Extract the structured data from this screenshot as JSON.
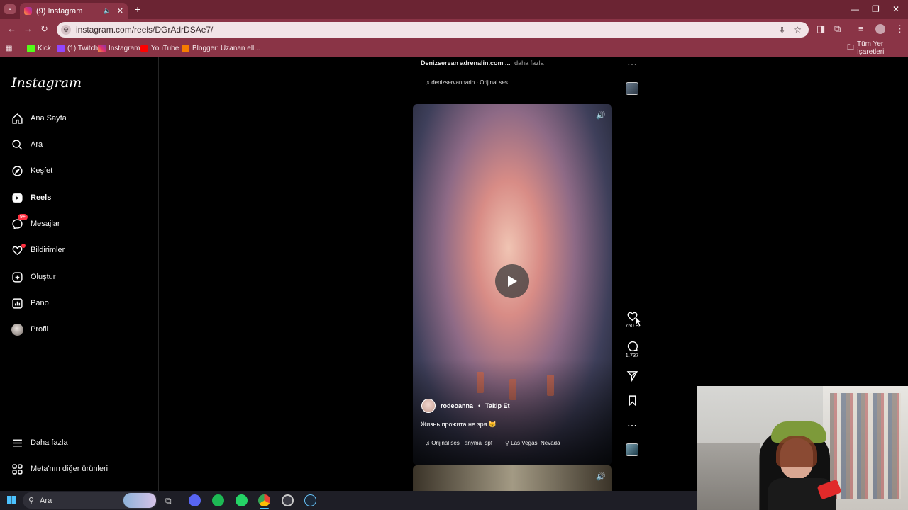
{
  "browser": {
    "tab_title": "(9) Instagram",
    "url": "instagram.com/reels/DGrAdrDSAe7/",
    "bookmarks": [
      "Kick",
      "(1) Twitch",
      "Instagram",
      "YouTube",
      "Blogger: Uzanan ell..."
    ],
    "all_bookmarks": "Tüm Yer İşaretleri"
  },
  "sidebar": {
    "logo": "Instagram",
    "items": [
      {
        "label": "Ana Sayfa",
        "icon": "home-icon"
      },
      {
        "label": "Ara",
        "icon": "search-icon"
      },
      {
        "label": "Keşfet",
        "icon": "compass-icon"
      },
      {
        "label": "Reels",
        "icon": "reels-icon"
      },
      {
        "label": "Mesajlar",
        "icon": "messenger-icon",
        "badge": "9+"
      },
      {
        "label": "Bildirimler",
        "icon": "heart-icon"
      },
      {
        "label": "Oluştur",
        "icon": "plus-icon"
      },
      {
        "label": "Pano",
        "icon": "chart-icon"
      },
      {
        "label": "Profil",
        "icon": "avatar"
      }
    ],
    "more": "Daha fazla",
    "meta": "Meta'nın diğer ürünleri"
  },
  "prev_post": {
    "caption_user": "Denizservan adrenalin.com ...",
    "caption_more": "daha fazla",
    "music": "denizservannarin · Orijinal ses"
  },
  "reel": {
    "username": "rodeoanna",
    "follow": "Takip Et",
    "caption": "Жизнь прожита не зря 😸",
    "audio": "Orijinal ses",
    "audio_user": "anyma_spf",
    "location": "Las Vegas, Nevada",
    "likes": "750 B",
    "comments": "1.737"
  },
  "taskbar": {
    "search": "Ara"
  },
  "colors": {
    "chrome_dark": "#6b2433",
    "chrome": "#8a3446",
    "notify_red": "#ff3040"
  }
}
